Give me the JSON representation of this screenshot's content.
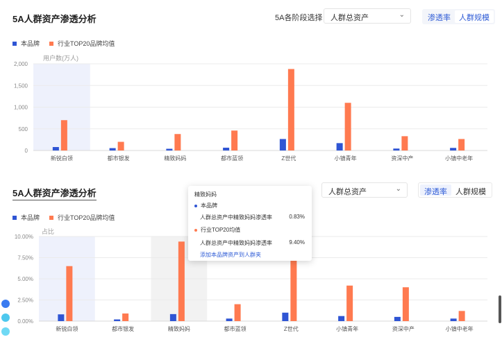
{
  "panel1": {
    "title": "5A人群资产渗透分析",
    "stage_label": "5A各阶段选择",
    "select_value": "人群总资产",
    "toggle": [
      "渗透率",
      "人群规模"
    ],
    "legend": [
      "本品牌",
      "行业TOP20品牌均值"
    ],
    "unit": "用户数(万人)"
  },
  "panel2": {
    "title": "5A人群资产渗透分析",
    "select_value": "人群总资产",
    "toggle": [
      "渗透率",
      "人群规模"
    ],
    "legend": [
      "本品牌",
      "行业TOP20品牌均值"
    ],
    "unit": "占比"
  },
  "tooltip": {
    "title": "精致妈妈",
    "brand_label": "本品牌",
    "brand_metric": "人群总资产中精致妈妈渗透率",
    "brand_value": "0.83%",
    "industry_label": "行业TOP20均值",
    "industry_metric": "人群总资产中精致妈妈渗透率",
    "industry_value": "9.40%",
    "link": "添加本品牌资产到人群夹"
  },
  "colors": {
    "brand": "#2f55d4",
    "industry": "#ff7a50",
    "accent": "#2e5bd6",
    "highlight": "#eef1fc",
    "highlight_gray": "#f2f2f2"
  },
  "chart_data": [
    {
      "type": "bar",
      "categories": [
        "新锐白领",
        "都市银发",
        "精致妈妈",
        "都市蓝领",
        "Z世代",
        "小镇青年",
        "资深中产",
        "小镇中老年"
      ],
      "series": [
        {
          "name": "本品牌",
          "values": [
            80,
            55,
            40,
            65,
            265,
            170,
            45,
            60
          ]
        },
        {
          "name": "行业TOP20品牌均值",
          "values": [
            700,
            200,
            380,
            460,
            1880,
            1100,
            330,
            265
          ]
        }
      ],
      "ylim": [
        0,
        2000
      ],
      "yticks": [
        "0",
        "500",
        "1,000",
        "1,500",
        "2,000"
      ],
      "ylabel": "用户数(万人)"
    },
    {
      "type": "bar",
      "categories": [
        "新锐白领",
        "都市银发",
        "精致妈妈",
        "都市蓝领",
        "Z世代",
        "小镇青年",
        "资深中产",
        "小镇中老年"
      ],
      "series": [
        {
          "name": "本品牌",
          "values": [
            0.8,
            0.2,
            0.83,
            0.3,
            1.0,
            0.6,
            0.5,
            0.3
          ]
        },
        {
          "name": "行业TOP20品牌均值",
          "values": [
            6.5,
            0.9,
            9.4,
            2.0,
            9.0,
            4.2,
            4.0,
            1.2
          ]
        }
      ],
      "ylim": [
        0,
        10
      ],
      "yticks": [
        "0.00%",
        "2.50%",
        "5.00%",
        "7.50%",
        "10.00%"
      ],
      "ylabel": "占比"
    }
  ]
}
